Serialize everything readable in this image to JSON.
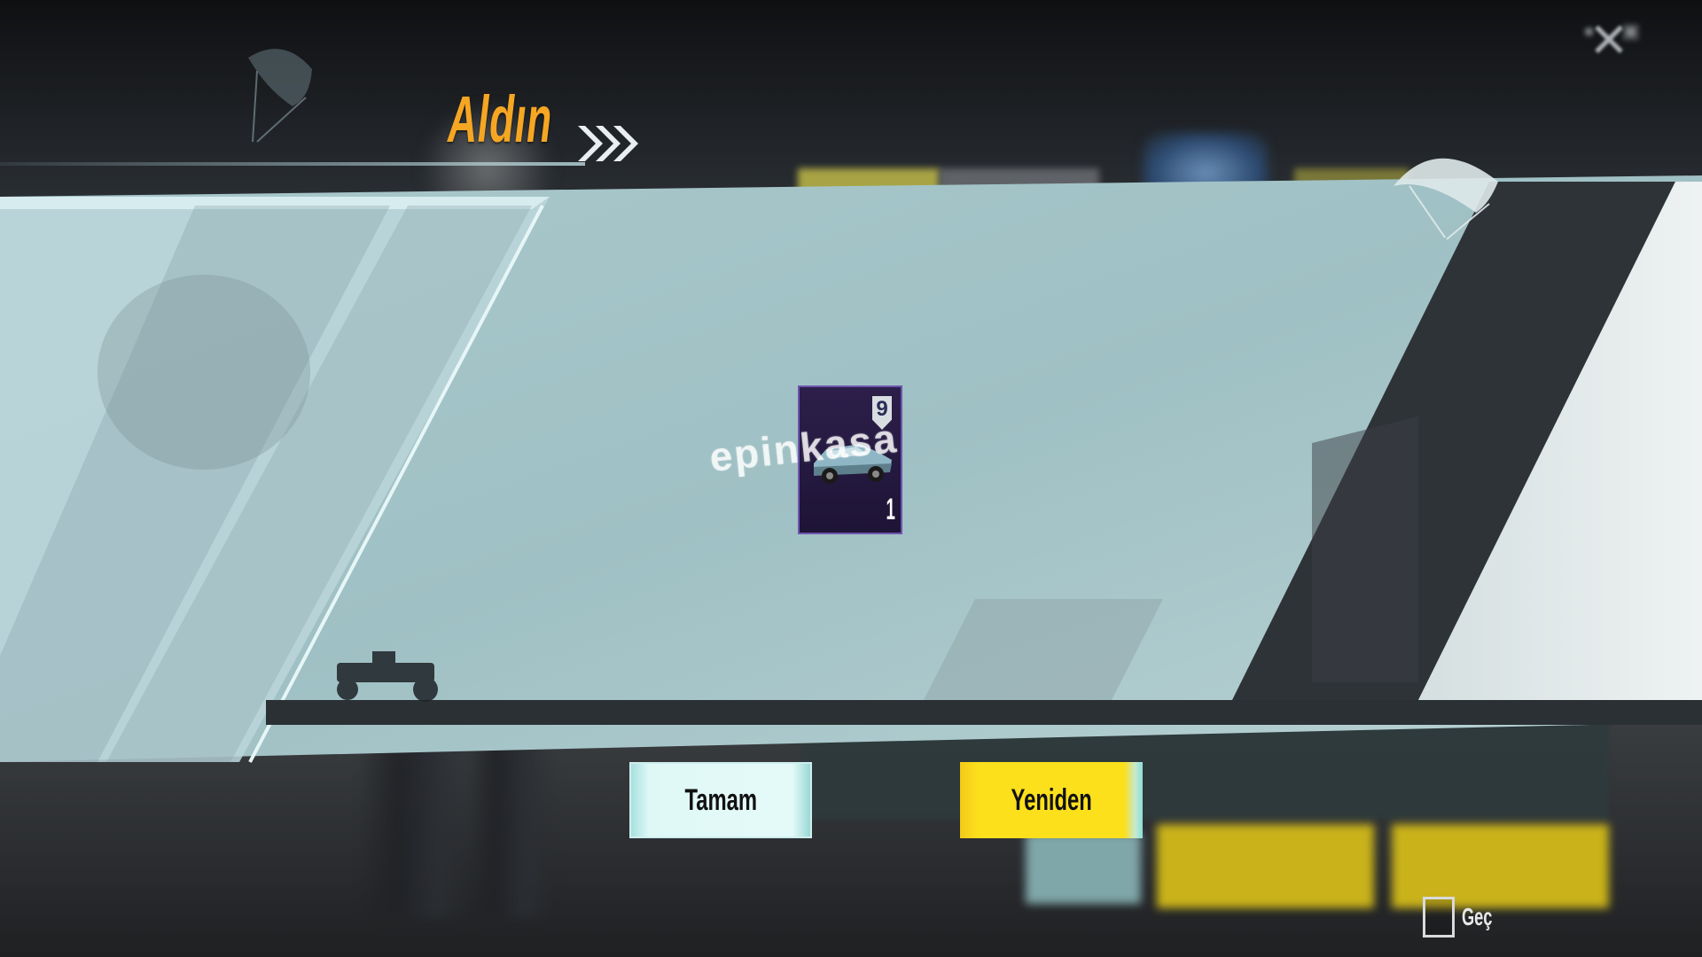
{
  "title": "Aldın",
  "reward": {
    "badge": "9",
    "count": "1",
    "icon": "car-icon"
  },
  "watermark": "epinkasa",
  "buttons": {
    "ok_label": "Tamam",
    "retry_label": "Yeniden"
  },
  "skip_label": "Geç",
  "colors": {
    "title": "#f5a623",
    "ok_button": "#dff8f6",
    "retry_button": "#fce01c",
    "banner": "#9fc0c4",
    "item_bg": "#2c1f4a"
  }
}
